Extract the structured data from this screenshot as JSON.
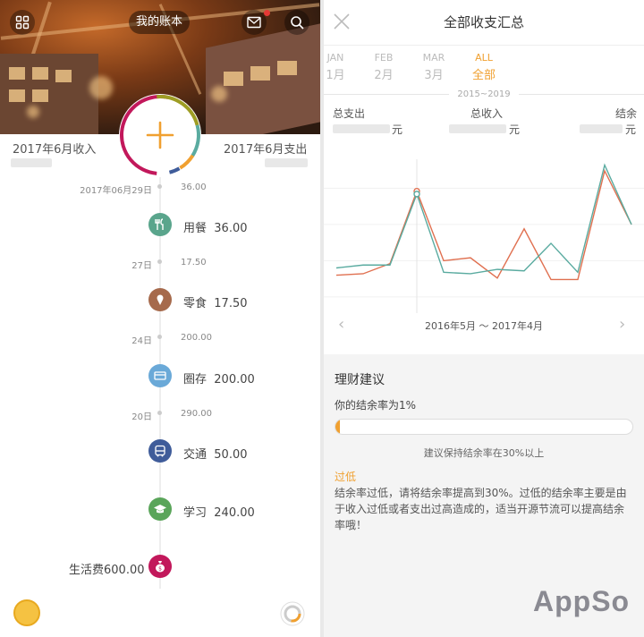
{
  "left": {
    "header": {
      "grid_icon": "grid-icon",
      "title": "我的账本",
      "mail_icon": "mail-icon",
      "search_icon": "search-icon"
    },
    "income_label": "2017年6月收入",
    "expense_label": "2017年6月支出",
    "add_icon": "plus-icon",
    "timeline": [
      {
        "date": "2017年06月29日",
        "amount": "36.00"
      },
      {
        "date": "27日",
        "amount": "17.50"
      },
      {
        "date": "24日",
        "amount": "200.00"
      },
      {
        "date": "20日",
        "amount": "290.00"
      }
    ],
    "records": [
      {
        "label": "用餐",
        "amount": "36.00",
        "icon": "dining-icon",
        "color": "#5aa58c"
      },
      {
        "label": "零食",
        "amount": "17.50",
        "icon": "icecream-icon",
        "color": "#a66a4c"
      },
      {
        "label": "圈存",
        "amount": "200.00",
        "icon": "card-icon",
        "color": "#6aa9d8"
      },
      {
        "label": "交通",
        "amount": "50.00",
        "icon": "bus-icon",
        "color": "#3f5c9a"
      },
      {
        "label": "学习",
        "amount": "240.00",
        "icon": "graduation-icon",
        "color": "#5aa55a"
      }
    ],
    "income_record": {
      "label": "生活费600.00",
      "icon": "moneybag-icon",
      "color": "#c2185b"
    },
    "coin_icon": "coin-icon",
    "pie_icon": "pie-chart-icon",
    "colors": {
      "accent": "#f0a030"
    }
  },
  "right": {
    "close_icon": "close-icon",
    "title": "全部收支汇总",
    "tabs": [
      {
        "en": "JAN",
        "zh": "1月"
      },
      {
        "en": "FEB",
        "zh": "2月"
      },
      {
        "en": "MAR",
        "zh": "3月"
      },
      {
        "en": "ALL",
        "zh": "全部",
        "active": true
      }
    ],
    "range": "2015~2019",
    "stats": {
      "expense_label": "总支出",
      "income_label": "总收入",
      "balance_label": "结余",
      "unit": "元"
    },
    "chart_data": {
      "type": "line",
      "x": [
        1,
        2,
        3,
        4,
        5,
        6,
        7,
        8,
        9,
        10,
        11,
        12
      ],
      "series": [
        {
          "color": "#e07050",
          "values": [
            20,
            21,
            28,
            78,
            30,
            32,
            18,
            52,
            17,
            17,
            92,
            55
          ]
        },
        {
          "color": "#5aaba0",
          "values": [
            25,
            27,
            27,
            76,
            22,
            21,
            24,
            23,
            42,
            22,
            96,
            55
          ]
        }
      ],
      "ylim": [
        0,
        100
      ],
      "highlight_index": 3
    },
    "period": "2016年5月 ～ 2017年4月",
    "prev_icon": "chevron-left-icon",
    "next_icon": "chevron-right-icon",
    "advice": {
      "title": "理财建议",
      "rate_text": "你的结余率为1%",
      "rate_value": 0.01,
      "suggest": "建议保持结余率在30%以上",
      "level": "过低",
      "text": "结余率过低，请将结余率提高到30%。过低的结余率主要是由于收入过低或者支出过高造成的，适当开源节流可以提高结余率哦！"
    },
    "logo": "AppSo"
  }
}
